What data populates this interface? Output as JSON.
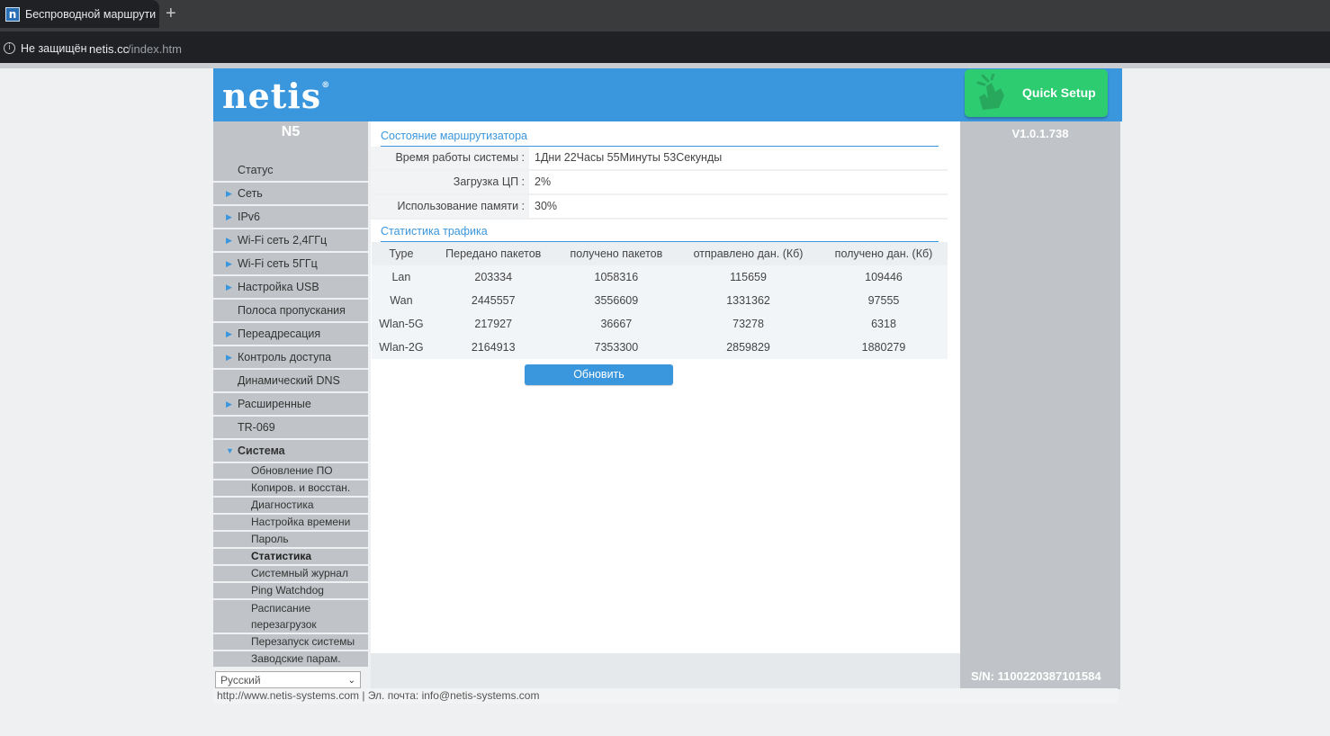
{
  "browser": {
    "tab_title": "Беспроводной маршрутиз",
    "new_tab_glyph": "+",
    "security_label": "Не защищён",
    "url_domain": "netis.cc",
    "url_path": "/index.htm"
  },
  "header": {
    "logo": "netis",
    "logo_mark": "®",
    "quick_setup": "Quick Setup"
  },
  "sidebar": {
    "model": "N5",
    "items": [
      {
        "label": "Статус",
        "arrow": false
      },
      {
        "label": "Сеть",
        "arrow": true
      },
      {
        "label": "IPv6",
        "arrow": true
      },
      {
        "label": "Wi-Fi сеть 2,4ГГц",
        "arrow": true
      },
      {
        "label": "Wi-Fi сеть 5ГГц",
        "arrow": true
      },
      {
        "label": "Настройка USB",
        "arrow": true
      },
      {
        "label": "Полоса пропускания",
        "arrow": false
      },
      {
        "label": "Переадресация",
        "arrow": true
      },
      {
        "label": "Контроль доступа",
        "arrow": true
      },
      {
        "label": "Динамический DNS",
        "arrow": false
      },
      {
        "label": "Расширенные",
        "arrow": true
      },
      {
        "label": "TR-069",
        "arrow": false
      },
      {
        "label": "Система",
        "arrow": true,
        "open": true
      }
    ],
    "arrow_glyph": "▶",
    "open_arrow_glyph": "▼",
    "subitems": [
      {
        "label": "Обновление ПО"
      },
      {
        "label": "Копиров. и восстан."
      },
      {
        "label": "Диагностика"
      },
      {
        "label": "Настройка времени"
      },
      {
        "label": "Пароль"
      },
      {
        "label": "Статистика",
        "active": true
      },
      {
        "label": "Системный журнал"
      },
      {
        "label": "Ping Watchdog"
      },
      {
        "label": "Расписание перезагрузок",
        "tall": true
      },
      {
        "label": "Перезапуск системы"
      },
      {
        "label": "Заводские парам."
      }
    ],
    "language": "Русский"
  },
  "status": {
    "title": "Состояние маршрутизатора",
    "uptime_label": "Время работы системы :",
    "uptime_value": "1Дни 22Часы 55Минуты 53Секунды",
    "cpu_label": "Загрузка ЦП :",
    "cpu_value": "2%",
    "mem_label": "Использование памяти :",
    "mem_value": "30%"
  },
  "traffic": {
    "title": "Статистика трафика",
    "columns": [
      "Type",
      "Передано пакетов",
      "получено пакетов",
      "отправлено дан. (Кб)",
      "получено дан. (Кб)"
    ],
    "rows": [
      [
        "Lan",
        "203334",
        "1058316",
        "115659",
        "109446"
      ],
      [
        "Wan",
        "2445557",
        "3556609",
        "1331362",
        "97555"
      ],
      [
        "Wlan-5G",
        "217927",
        "36667",
        "73278",
        "6318"
      ],
      [
        "Wlan-2G",
        "2164913",
        "7353300",
        "2859829",
        "1880279"
      ]
    ],
    "refresh_button": "Обновить"
  },
  "right_panel": {
    "version": "V1.0.1.738",
    "serial": "S/N: 1100220387101584"
  },
  "footer": {
    "text": "http://www.netis-systems.com | Эл. почта: info@netis-systems.com"
  },
  "colors": {
    "brand_blue": "#3a96dd",
    "quick_setup_green": "#2ecc71",
    "sidebar_gray": "#c0c4c8"
  }
}
